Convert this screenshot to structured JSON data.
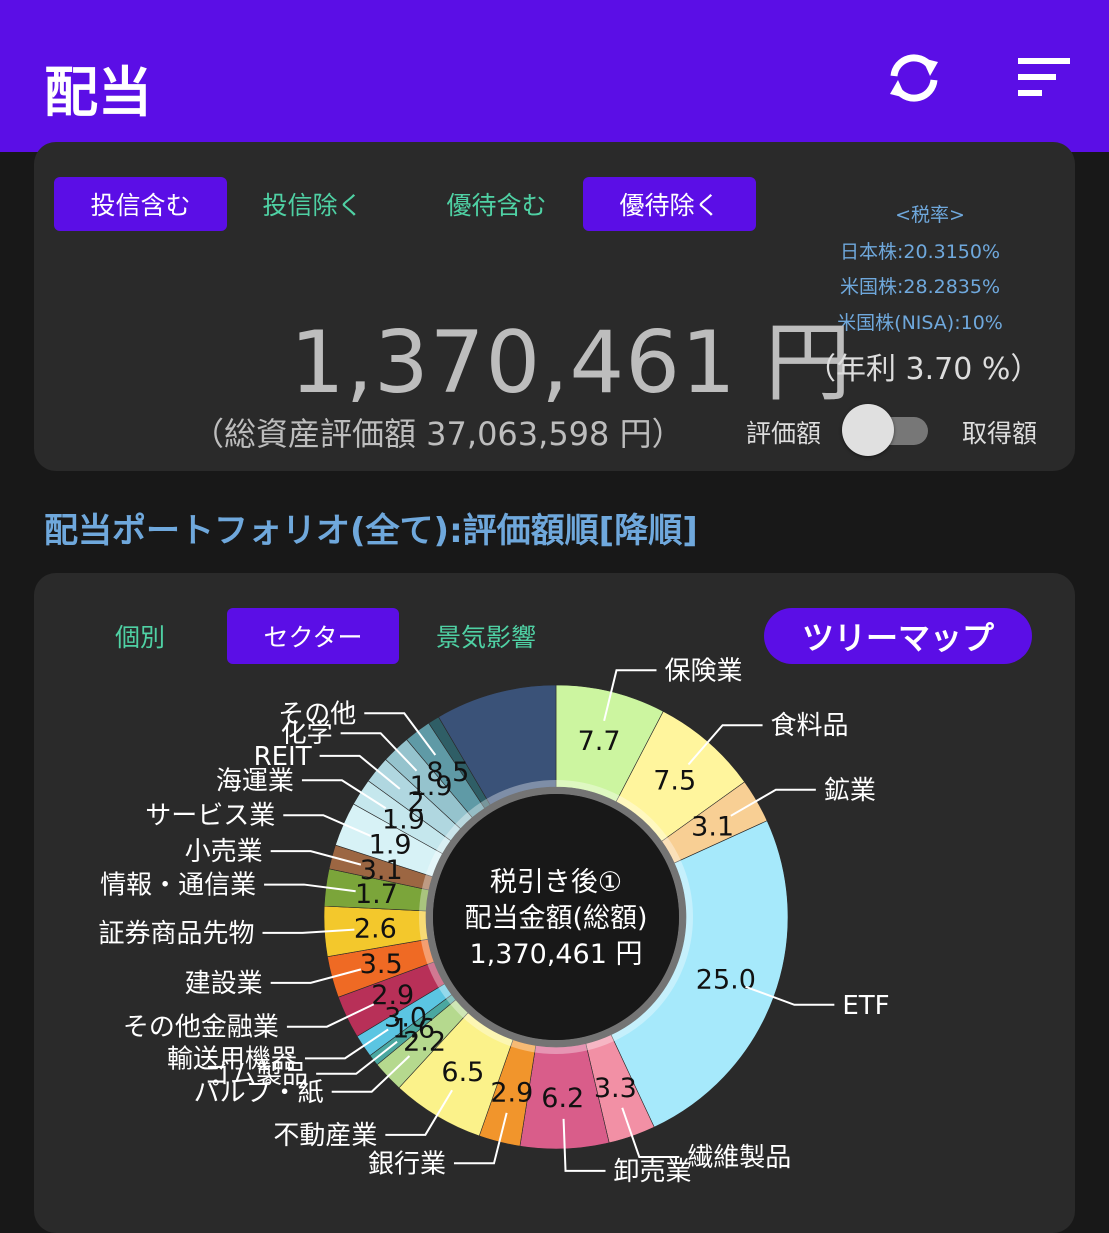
{
  "appbar": {
    "title": "配当",
    "refresh_icon": "refresh-icon",
    "sort_icon": "sort-icon"
  },
  "filters": {
    "fund_include": "投信含む",
    "fund_exclude": "投信除く",
    "benefit_include": "優待含む",
    "benefit_exclude": "優待除く"
  },
  "tax": {
    "title": "<税率>",
    "japan": "日本株:20.3150%",
    "us": "米国株:28.2835%",
    "us_nisa": "米国株(NISA):10%"
  },
  "summary": {
    "amount": "1,370,461 円",
    "yield": "（年利 3.70 %）",
    "total_assets": "（総資産評価額 37,063,598 円）",
    "toggle_left": "評価額",
    "toggle_right": "取得額",
    "toggle_state": "off"
  },
  "section_title": "配当ポートフォリオ(全て):評価額順[降順]",
  "tabs": {
    "individual": "個別",
    "sector": "セクター",
    "economy": "景気影響",
    "treemap": "ツリーマップ"
  },
  "colors": {
    "accent": "#5b0ee6",
    "teal": "#4fd1a4",
    "blue_text": "#6fa8dc"
  },
  "chart_data": {
    "type": "pie",
    "center_text": [
      "税引き後①",
      "配当金額(総額)",
      "1,370,461 円"
    ],
    "series": [
      {
        "label": "保険業",
        "value": 7.7,
        "color": "#ccf5a0"
      },
      {
        "label": "食料品",
        "value": 7.5,
        "color": "#fff59d"
      },
      {
        "label": "鉱業",
        "value": 3.1,
        "color": "#f8cf94"
      },
      {
        "label": "ETF",
        "value": 25.0,
        "color": "#a6e9fb"
      },
      {
        "label": "繊維製品",
        "value": 3.3,
        "color": "#f290a5"
      },
      {
        "label": "卸売業",
        "value": 6.2,
        "color": "#d95d8a"
      },
      {
        "label": "銀行業",
        "value": 2.9,
        "color": "#f1952c"
      },
      {
        "label": "不動産業",
        "value": 6.5,
        "color": "#fbf28a"
      },
      {
        "label": "パルプ・紙",
        "value": 2.2,
        "color": "#b5d98e"
      },
      {
        "label": "ゴム製品",
        "value": 0.8,
        "color": "#4aa7a0"
      },
      {
        "label": "輸送用機器",
        "value": 1.6,
        "color": "#5bc5e2"
      },
      {
        "label": "その他金融業",
        "value": 3.0,
        "color": "#b83058"
      },
      {
        "label": "建設業",
        "value": 2.9,
        "color": "#ef6a24"
      },
      {
        "label": "証券商品先物",
        "value": 3.5,
        "color": "#f3c82c"
      },
      {
        "label": "情報・通信業",
        "value": 2.6,
        "color": "#7ba53a"
      },
      {
        "label": "小売業",
        "value": 1.7,
        "color": "#9c6642"
      },
      {
        "label": "サービス業",
        "value": 3.1,
        "color": "#d7f2f6"
      },
      {
        "label": "海運業",
        "value": 1.9,
        "color": "#c5e7ed"
      },
      {
        "label": "REIT",
        "value": 1.9,
        "color": "#b0d7e0"
      },
      {
        "label": "化学",
        "value": 2.0,
        "color": "#95c3cd"
      },
      {
        "label": "その他",
        "value": 1.9,
        "color": "#5f9aa6"
      },
      {
        "label": "",
        "value": 0.8,
        "color": "#2f5e66"
      },
      {
        "label": "",
        "value": 8.5,
        "color": "#3a5278"
      }
    ],
    "data_labels": [
      "7.7",
      "7.5",
      "3.1",
      "25.0",
      "3.3",
      "6.2",
      "2.9",
      "6.5",
      "2.2",
      "1.6",
      "3.0",
      "2.9",
      "3.5",
      "2.6",
      "1.7",
      "3.1",
      "1.9",
      "1.9",
      "2",
      "1.9",
      "8.5"
    ]
  }
}
